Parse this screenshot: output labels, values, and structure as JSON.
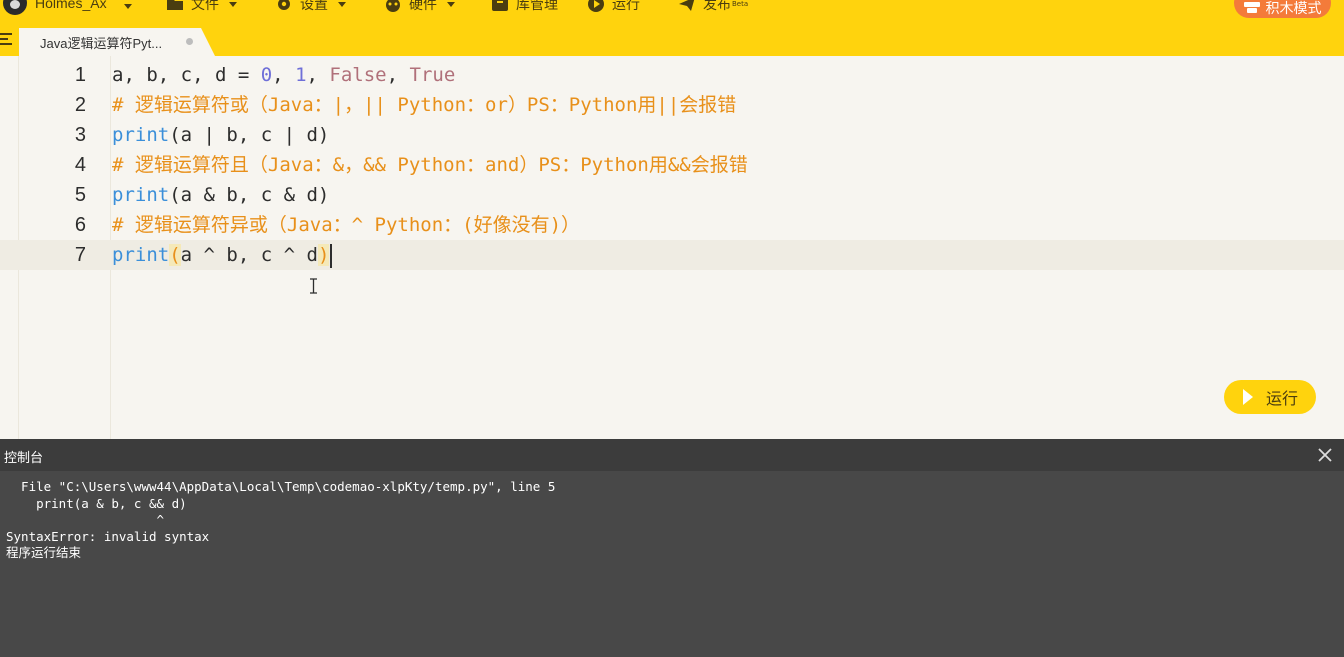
{
  "topbar": {
    "username": "Holmes_Ax",
    "menu": {
      "file": "文件",
      "settings": "设置",
      "hardware": "硬件",
      "library": "库管理",
      "run": "运行",
      "publish": "发布",
      "publish_badge": "Beta"
    },
    "mode_button": "积木模式"
  },
  "tab": {
    "title": "Java逻辑运算符Pyt..."
  },
  "editor": {
    "lines": [
      {
        "num": "1",
        "tokens": [
          [
            "plain",
            "a, b, c, d = "
          ],
          [
            "num",
            "0"
          ],
          [
            "plain",
            ", "
          ],
          [
            "num",
            "1"
          ],
          [
            "plain",
            ", "
          ],
          [
            "bool",
            "False"
          ],
          [
            "plain",
            ", "
          ],
          [
            "bool",
            "True"
          ]
        ]
      },
      {
        "num": "2",
        "tokens": [
          [
            "cmt",
            "# 逻辑运算符或（Java：|，|| Python：or）PS：Python用||会报错"
          ]
        ]
      },
      {
        "num": "3",
        "tokens": [
          [
            "kw",
            "print"
          ],
          [
            "plain",
            "(a | b, c | d)"
          ]
        ]
      },
      {
        "num": "4",
        "tokens": [
          [
            "cmt",
            "# 逻辑运算符且（Java：&，&& Python：and）PS：Python用&&会报错"
          ]
        ]
      },
      {
        "num": "5",
        "tokens": [
          [
            "kw",
            "print"
          ],
          [
            "plain",
            "(a & b, c & d)"
          ]
        ]
      },
      {
        "num": "6",
        "tokens": [
          [
            "cmt",
            "# 逻辑运算符异或（Java：^ Python：(好像没有)）"
          ]
        ]
      },
      {
        "num": "7",
        "tokens": [
          [
            "kw",
            "print"
          ],
          [
            "paren",
            "("
          ],
          [
            "plain",
            "a ^ b, c ^ d"
          ],
          [
            "paren",
            ")"
          ]
        ]
      }
    ],
    "active_line": 7,
    "run_button": "运行"
  },
  "console": {
    "title": "控制台",
    "output": "  File \"C:\\Users\\www44\\AppData\\Local\\Temp\\codemao-xlpKty/temp.py\", line 5\n    print(a & b, c && d)\n                    ^\nSyntaxError: invalid syntax\n程序运行结束"
  },
  "colors": {
    "accent": "#ffd30d",
    "mode_button": "#f47b3a",
    "keyword": "#3b8fd9",
    "comment": "#e8901a",
    "number": "#6f6fd8",
    "boolean": "#b0707a",
    "console_bg": "#484848"
  }
}
